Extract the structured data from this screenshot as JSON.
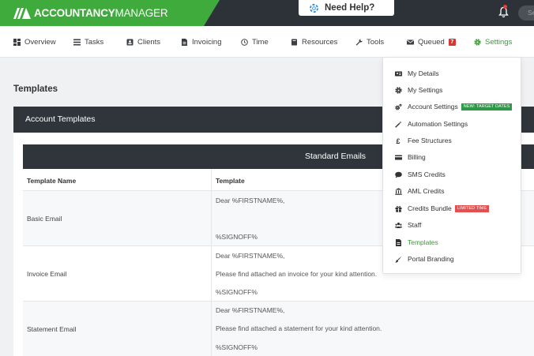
{
  "brand": {
    "name_bold": "ACCOUNTANCY",
    "name_light": "MANAGER"
  },
  "topbar": {
    "help_label": "Need Help?",
    "search_placeholder": "Se"
  },
  "nav": {
    "items": [
      {
        "label": "Overview",
        "icon": "dashboard-icon"
      },
      {
        "label": "Tasks",
        "icon": "tasks-icon"
      },
      {
        "label": "Clients",
        "icon": "clients-icon"
      },
      {
        "label": "Invoicing",
        "icon": "invoice-icon"
      },
      {
        "label": "Time",
        "icon": "clock-icon"
      },
      {
        "label": "Resources",
        "icon": "book-icon"
      },
      {
        "label": "Tools",
        "icon": "wrench-icon"
      },
      {
        "label": "Queued",
        "icon": "envelope-icon",
        "badge": "7"
      },
      {
        "label": "Settings",
        "icon": "gear-icon",
        "active": true
      }
    ]
  },
  "page": {
    "title": "Templates"
  },
  "panel": {
    "title": "Account Templates",
    "section_title": "Standard Emails",
    "columns": [
      "Template Name",
      "Template"
    ],
    "rows": [
      {
        "name": "Basic Email",
        "lines": [
          "Dear %FIRSTNAME%,",
          "%SIGNOFF%"
        ]
      },
      {
        "name": "Invoice Email",
        "lines": [
          "Dear %FIRSTNAME%,",
          "Please find attached an invoice for your kind attention.",
          "%SIGNOFF%"
        ]
      },
      {
        "name": "Statement Email",
        "lines": [
          "Dear %FIRSTNAME%,",
          "Please find attached a statement for your kind attention.",
          "%SIGNOFF%"
        ]
      }
    ]
  },
  "settings_menu": {
    "items": [
      {
        "label": "My Details",
        "icon": "id-card-icon"
      },
      {
        "label": "My Settings",
        "icon": "gear-icon"
      },
      {
        "label": "Account Settings",
        "icon": "gears-icon",
        "badge": "NEW: TARGET DATES"
      },
      {
        "label": "Automation Settings",
        "icon": "magic-wand-icon"
      },
      {
        "label": "Fee Structures",
        "icon": "pound-icon"
      },
      {
        "label": "Billing",
        "icon": "credit-card-icon"
      },
      {
        "label": "SMS Credits",
        "icon": "chat-icon"
      },
      {
        "label": "AML Credits",
        "icon": "bank-icon"
      },
      {
        "label": "Credits Bundle",
        "icon": "gift-icon",
        "badge": "LIMITED TIME"
      },
      {
        "label": "Staff",
        "icon": "users-icon"
      },
      {
        "label": "Templates",
        "icon": "file-icon",
        "active": true
      },
      {
        "label": "Portal Branding",
        "icon": "brush-icon"
      }
    ]
  },
  "colors": {
    "brand_green": "#3eab3c",
    "topbar": "#2d3238",
    "active_green": "#3a9b37",
    "badge_red": "#d9362f"
  }
}
